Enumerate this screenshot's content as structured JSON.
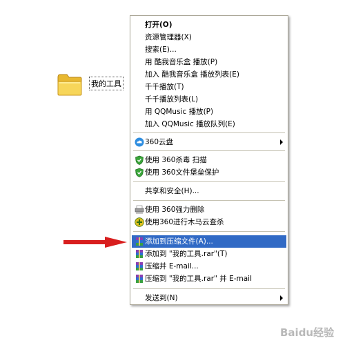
{
  "desktop": {
    "folder_label": "我的工具"
  },
  "menu": {
    "items": [
      {
        "label": "打开(O)"
      },
      {
        "label": "资源管理器(X)"
      },
      {
        "label": "搜索(E)..."
      },
      {
        "label": "用 酷我音乐盒 播放(P)"
      },
      {
        "label": "加入 酷我音乐盒 播放列表(E)"
      },
      {
        "label": "千千播放(T)"
      },
      {
        "label": "千千播放列表(L)"
      },
      {
        "label": "用 QQMusic 播放(P)"
      },
      {
        "label": "加入 QQMusic 播放队列(E)"
      },
      {
        "label": "360云盘"
      },
      {
        "label": "使用 360杀毒 扫描"
      },
      {
        "label": "使用 360文件堡垒保护"
      },
      {
        "label": "共享和安全(H)..."
      },
      {
        "label": "使用 360强力删除"
      },
      {
        "label": "使用360进行木马云查杀"
      },
      {
        "label": "添加到压缩文件(A)..."
      },
      {
        "label": "添加到 \"我的工具.rar\"(T)"
      },
      {
        "label": "压缩并 E-mail..."
      },
      {
        "label": "压缩到 \"我的工具.rar\" 并 E-mail"
      },
      {
        "label": "发送到(N)"
      }
    ]
  },
  "watermark": {
    "text": "Baidu经验"
  },
  "colors": {
    "highlight": "#316ac5",
    "arrow": "#d81e1e",
    "menu_border": "#aca899"
  }
}
